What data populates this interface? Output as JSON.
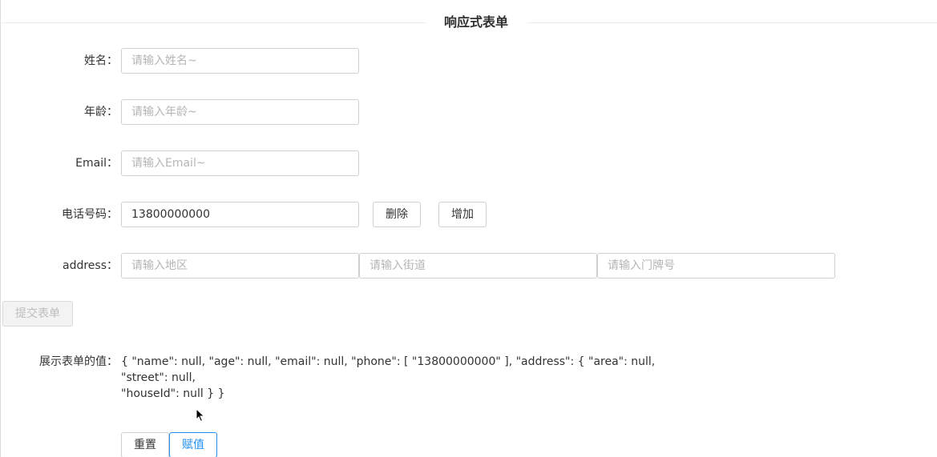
{
  "header": {
    "title": "响应式表单"
  },
  "form": {
    "name": {
      "label": "姓名：",
      "placeholder": "请输入姓名~",
      "value": ""
    },
    "age": {
      "label": "年龄：",
      "placeholder": "请输入年龄~",
      "value": ""
    },
    "email": {
      "label": "Email：",
      "placeholder": "请输入Email~",
      "value": ""
    },
    "phone": {
      "label": "电话号码：",
      "value": "13800000000",
      "delete_label": "删除",
      "add_label": "增加"
    },
    "address": {
      "label": "address：",
      "area_placeholder": "请输入地区",
      "street_placeholder": "请输入街道",
      "house_placeholder": "请输入门牌号"
    },
    "submit_label": "提交表单"
  },
  "display": {
    "label": "展示表单的值：",
    "line1": "{ \"name\": null, \"age\": null, \"email\": null, \"phone\": [ \"13800000000\" ], \"address\": { \"area\": null, \"street\": null,",
    "line2": "\"houseId\": null } }"
  },
  "actions": {
    "reset_label": "重置",
    "assign_label": "赋值"
  },
  "colors": {
    "primary": "#1e8ef5",
    "border": "#cfcfcf",
    "placeholder": "#b5b5b5"
  }
}
